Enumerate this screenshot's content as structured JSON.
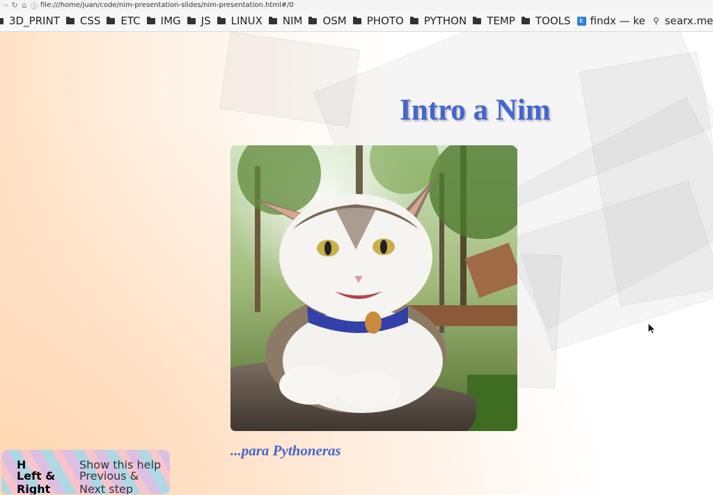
{
  "browser": {
    "url": "file:///home/juan/code/nim-presentation-slides/nim-presentation.html#/0",
    "bookmarks": [
      {
        "label": "3D_PRINT",
        "icon": "folder-icon"
      },
      {
        "label": "CSS",
        "icon": "folder-icon"
      },
      {
        "label": "ETC",
        "icon": "folder-icon"
      },
      {
        "label": "IMG",
        "icon": "folder-icon"
      },
      {
        "label": "JS",
        "icon": "folder-icon"
      },
      {
        "label": "LINUX",
        "icon": "folder-icon"
      },
      {
        "label": "NIM",
        "icon": "folder-icon"
      },
      {
        "label": "OSM",
        "icon": "folder-icon"
      },
      {
        "label": "PHOTO",
        "icon": "folder-icon"
      },
      {
        "label": "PYTHON",
        "icon": "folder-icon"
      },
      {
        "label": "TEMP",
        "icon": "folder-icon"
      },
      {
        "label": "TOOLS",
        "icon": "folder-icon"
      },
      {
        "label": "findx — ke",
        "icon": "findx-icon"
      },
      {
        "label": "searx.me",
        "icon": "searx-icon"
      }
    ]
  },
  "slide": {
    "title": "Intro a Nim",
    "subtitle": "...para Pythoneras",
    "image_alt": "Smiling cat with blue collar",
    "accent_color": "#4466cc"
  },
  "help": {
    "rows": [
      {
        "key": "H",
        "desc": "Show this help"
      },
      {
        "key": "Left & Right",
        "desc": "Previous & Next step"
      }
    ]
  }
}
